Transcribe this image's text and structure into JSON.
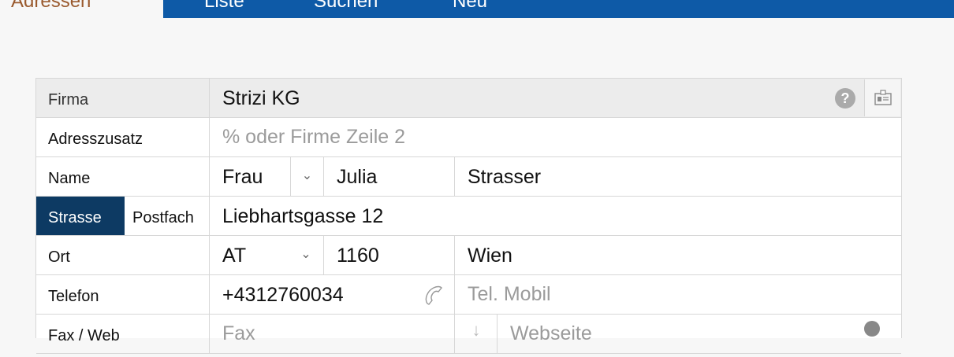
{
  "tabs": [
    {
      "label": "Adressen"
    },
    {
      "label": "Liste"
    },
    {
      "label": "Suchen"
    },
    {
      "label": "Neu"
    }
  ],
  "form": {
    "firma": {
      "label": "Firma",
      "value": "Strizi KG"
    },
    "adresszusatz": {
      "label": "Adresszusatz",
      "placeholder": "% oder Firme Zeile 2"
    },
    "name": {
      "label": "Name",
      "salutation": "Frau",
      "first_name": "Julia",
      "last_name": "Strasser"
    },
    "address_type": {
      "strasse": "Strasse",
      "postfach": "Postfach",
      "value": "Liebhartsgasse 12"
    },
    "ort": {
      "label": "Ort",
      "country": "AT",
      "zip": "1160",
      "city": "Wien"
    },
    "telefon": {
      "label": "Telefon",
      "value": "+4312760034",
      "mobile_placeholder": "Tel. Mobil"
    },
    "fax_web": {
      "label": "Fax / Web",
      "fax_placeholder": "Fax",
      "web_placeholder": "Webseite"
    }
  },
  "colors": {
    "tab_bar": "#0e5aa7",
    "active_tab_text": "#9a5a2e",
    "toggle_active": "#0d3a63"
  }
}
